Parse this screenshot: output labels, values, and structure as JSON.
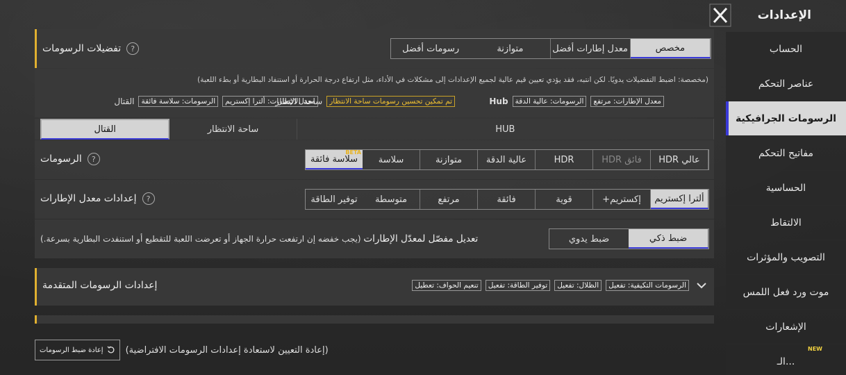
{
  "header": {
    "title": "الإعدادات",
    "close_icon": "close-icon"
  },
  "sidebar": {
    "items": [
      {
        "label": "الحساب",
        "active": false
      },
      {
        "label": "عناصر التحكم",
        "active": false
      },
      {
        "label": "الرسومات الجرافيكية",
        "active": true
      },
      {
        "label": "مفاتيح التحكم",
        "active": false
      },
      {
        "label": "الحساسية",
        "active": false
      },
      {
        "label": "الالتقاط",
        "active": false
      },
      {
        "label": "التصويب والمؤثرات",
        "active": false
      },
      {
        "label": "موت ورد فعل اللمس",
        "active": false
      },
      {
        "label": "الإشعارات",
        "active": false
      },
      {
        "label": "الـ...",
        "active": false,
        "badge": "NEW"
      }
    ]
  },
  "prefs": {
    "title": "تفضيلات الرسومات",
    "options": [
      "مخصص",
      "معدل إطارات أفضل",
      "متوازنة",
      "رسومات أفضل"
    ],
    "selected": "مخصص"
  },
  "info": {
    "text": "(مخصصة: اضبط التفضيلات يدويًا. لكن انتبه، فقد يؤدي تعيين قيم عالية لجميع الإعدادات إلى مشكلات في الأداء، مثل ارتفاع درجة الحرارة أو استنفاد البطارية أو بطء اللعبة)",
    "hub_label": "Hub",
    "hub_tags": [
      "معدل الإطارات: مرتفع",
      "الرسومات: عالية الدقة"
    ],
    "lobby_label": "ساحة الانتظار",
    "lobby_tag": "تم تمكين تحسين رسومات ساحة الانتظار",
    "combat_label": "القتال",
    "combat_tags": [
      "معدل الإطارات: ألترا إكستريم",
      "الرسومات: سلاسة فائقة"
    ]
  },
  "tabs": [
    "HUB",
    "ساحة الانتظار",
    "القتال"
  ],
  "tabs_selected": "القتال",
  "graphics": {
    "title": "الرسومات",
    "options": [
      "عالي HDR",
      "فائق HDR",
      "HDR",
      "عالية الدقة",
      "متوازنة",
      "سلاسة",
      "سلاسة فائقة"
    ],
    "selected": "سلاسة فائقة",
    "beta": "BETA"
  },
  "fps": {
    "title": "إعدادات معدل الإطارات",
    "options": [
      "ألترا إكستريم",
      "إكستريم+",
      "قوية",
      "فائقة",
      "مرتفع",
      "متوسطة",
      "توفير الطاقة"
    ],
    "selected": "ألترا إكستريم"
  },
  "adaptive": {
    "title": "تعديل مفصّل لمعدّل الإطارات",
    "note": "(يجب خفضه إن ارتفعت حرارة الجهاز أو تعرضت اللعبة للتقطيع أو استنفدت البطارية بسرعة.)",
    "options": [
      "ضبط ذكي",
      "ضبط يدوي"
    ],
    "selected": "ضبط ذكي"
  },
  "advanced": {
    "title": "إعدادات الرسومات المتقدمة",
    "tags": [
      "الرسومات التكيفية: تفعيل",
      "الظلال: تفعيل",
      "توفير الطاقة: تفعيل",
      "تنعيم الحواف: تعطيل"
    ]
  },
  "reset": {
    "button": "إعادة ضبط الرسومات",
    "note": "(إعادة التعيين لاستعادة إعدادات الرسومات الافتراضية)"
  }
}
